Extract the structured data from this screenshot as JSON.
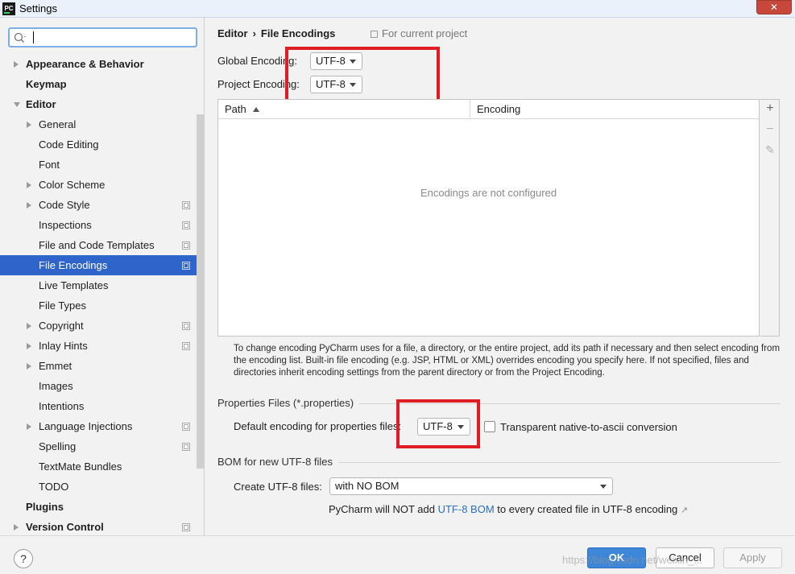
{
  "window": {
    "title": "Settings",
    "app_icon": "PC",
    "close_label": "✕"
  },
  "search": {
    "placeholder": ""
  },
  "sidebar": {
    "items": [
      {
        "label": "Appearance & Behavior",
        "bold": true,
        "arrow": "right",
        "indent": 0,
        "project": false,
        "selected": false
      },
      {
        "label": "Keymap",
        "bold": true,
        "arrow": "none",
        "indent": 0,
        "project": false,
        "selected": false
      },
      {
        "label": "Editor",
        "bold": true,
        "arrow": "down",
        "indent": 0,
        "project": false,
        "selected": false
      },
      {
        "label": "General",
        "bold": false,
        "arrow": "right",
        "indent": 1,
        "project": false,
        "selected": false
      },
      {
        "label": "Code Editing",
        "bold": false,
        "arrow": "none",
        "indent": 1,
        "project": false,
        "selected": false
      },
      {
        "label": "Font",
        "bold": false,
        "arrow": "none",
        "indent": 1,
        "project": false,
        "selected": false
      },
      {
        "label": "Color Scheme",
        "bold": false,
        "arrow": "right",
        "indent": 1,
        "project": false,
        "selected": false
      },
      {
        "label": "Code Style",
        "bold": false,
        "arrow": "right",
        "indent": 1,
        "project": true,
        "selected": false
      },
      {
        "label": "Inspections",
        "bold": false,
        "arrow": "none",
        "indent": 1,
        "project": true,
        "selected": false
      },
      {
        "label": "File and Code Templates",
        "bold": false,
        "arrow": "none",
        "indent": 1,
        "project": true,
        "selected": false
      },
      {
        "label": "File Encodings",
        "bold": false,
        "arrow": "none",
        "indent": 1,
        "project": true,
        "selected": true
      },
      {
        "label": "Live Templates",
        "bold": false,
        "arrow": "none",
        "indent": 1,
        "project": false,
        "selected": false
      },
      {
        "label": "File Types",
        "bold": false,
        "arrow": "none",
        "indent": 1,
        "project": false,
        "selected": false
      },
      {
        "label": "Copyright",
        "bold": false,
        "arrow": "right",
        "indent": 1,
        "project": true,
        "selected": false
      },
      {
        "label": "Inlay Hints",
        "bold": false,
        "arrow": "right",
        "indent": 1,
        "project": true,
        "selected": false
      },
      {
        "label": "Emmet",
        "bold": false,
        "arrow": "right",
        "indent": 1,
        "project": false,
        "selected": false
      },
      {
        "label": "Images",
        "bold": false,
        "arrow": "none",
        "indent": 1,
        "project": false,
        "selected": false
      },
      {
        "label": "Intentions",
        "bold": false,
        "arrow": "none",
        "indent": 1,
        "project": false,
        "selected": false
      },
      {
        "label": "Language Injections",
        "bold": false,
        "arrow": "right",
        "indent": 1,
        "project": true,
        "selected": false
      },
      {
        "label": "Spelling",
        "bold": false,
        "arrow": "none",
        "indent": 1,
        "project": true,
        "selected": false
      },
      {
        "label": "TextMate Bundles",
        "bold": false,
        "arrow": "none",
        "indent": 1,
        "project": false,
        "selected": false
      },
      {
        "label": "TODO",
        "bold": false,
        "arrow": "none",
        "indent": 1,
        "project": false,
        "selected": false
      },
      {
        "label": "Plugins",
        "bold": true,
        "arrow": "none",
        "indent": 0,
        "project": false,
        "selected": false
      },
      {
        "label": "Version Control",
        "bold": true,
        "arrow": "right",
        "indent": 0,
        "project": true,
        "selected": false
      }
    ]
  },
  "main": {
    "breadcrumb": {
      "parent": "Editor",
      "separator": "›",
      "current": "File Encodings"
    },
    "scope_label": "For current project",
    "global_encoding": {
      "label": "Global Encoding:",
      "value": "UTF-8"
    },
    "project_encoding": {
      "label": "Project Encoding:",
      "value": "UTF-8"
    },
    "table": {
      "columns": [
        "Path",
        "Encoding"
      ],
      "empty_text": "Encodings are not configured",
      "tools": {
        "add": "+",
        "remove": "−",
        "edit": "✎"
      }
    },
    "help_text": "To change encoding PyCharm uses for a file, a directory, or the entire project, add its path if necessary and then select encoding from the encoding list. Built-in file encoding (e.g. JSP, HTML or XML) overrides encoding you specify here. If not specified, files and directories inherit encoding settings from the parent directory or from the Project Encoding.",
    "properties": {
      "section_title": "Properties Files (*.properties)",
      "default_label": "Default encoding for properties files:",
      "default_value": "UTF-8",
      "transparent_label": "Transparent native-to-ascii conversion",
      "transparent_checked": false
    },
    "bom": {
      "section_title": "BOM for new UTF-8 files",
      "create_label": "Create UTF-8 files:",
      "create_value": "with NO BOM",
      "note_prefix": "PyCharm will NOT add",
      "note_link": "UTF-8 BOM",
      "note_suffix": "to every created file in UTF-8 encoding",
      "note_ext": "↗"
    }
  },
  "footer": {
    "help_label": "?",
    "ok_label": "OK",
    "cancel_label": "Cancel",
    "apply_label": "Apply",
    "watermark": "https://blog.csdn.net/weixin_..."
  },
  "colors": {
    "selection": "#2f65ca",
    "highlight_box": "#e01d25",
    "link": "#2a6fc9",
    "ok_button": "#3d86d8"
  }
}
